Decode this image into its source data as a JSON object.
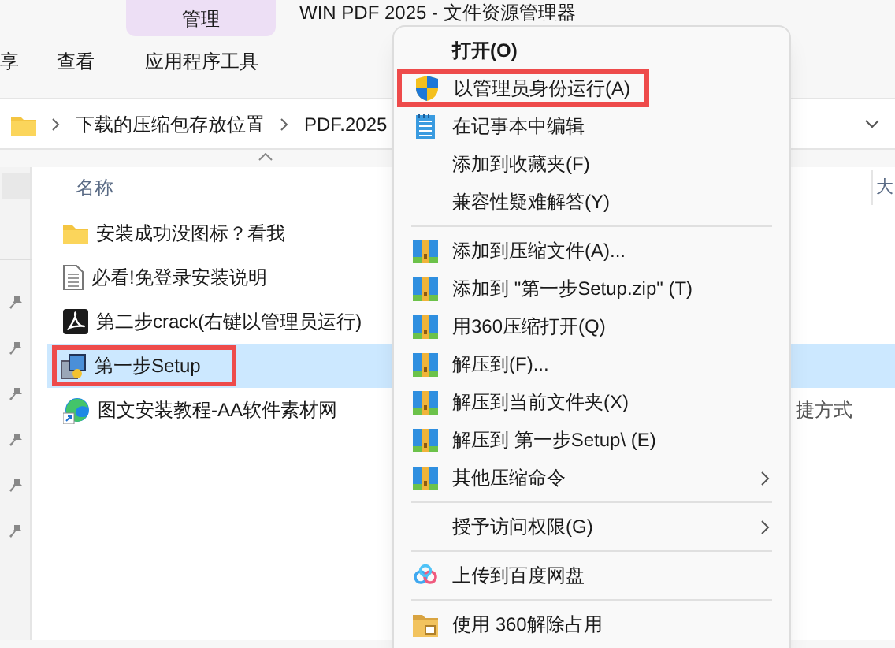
{
  "window": {
    "title": "WIN PDF 2025 - 文件资源管理器",
    "context_tab": "管理"
  },
  "ribbon": {
    "tabs": [
      {
        "label": "享"
      },
      {
        "label": "查看"
      },
      {
        "label": "应用程序工具"
      }
    ]
  },
  "address_bar": {
    "crumbs": [
      "下载的压缩包存放位置",
      "PDF.2025"
    ]
  },
  "columns": [
    {
      "label": "名称"
    },
    {
      "label": "大"
    }
  ],
  "files": [
    {
      "name": "安装成功没图标？看我",
      "kind": "folder",
      "selected": false,
      "highlighted": false
    },
    {
      "name": "必看!免登录安装说明",
      "kind": "document",
      "selected": false,
      "highlighted": false
    },
    {
      "name": "第二步crack(右键以管理员运行)",
      "kind": "pdf",
      "selected": false,
      "highlighted": false
    },
    {
      "name": "第一步Setup",
      "kind": "installer",
      "selected": true,
      "highlighted": true
    },
    {
      "name": "图文安装教程-AA软件素材网",
      "kind": "shortcut",
      "selected": false,
      "highlighted": false,
      "type": "捷方式"
    }
  ],
  "context_menu": [
    {
      "kind": "plain",
      "label": "打开(O)",
      "bold": true,
      "highlighted": false,
      "submenu": false
    },
    {
      "kind": "shield",
      "label": "以管理员身份运行(A)",
      "bold": false,
      "highlighted": true,
      "submenu": false
    },
    {
      "kind": "notepad",
      "label": "在记事本中编辑",
      "bold": false,
      "highlighted": false,
      "submenu": false
    },
    {
      "kind": "plain",
      "label": "添加到收藏夹(F)",
      "bold": false,
      "highlighted": false,
      "submenu": false
    },
    {
      "kind": "plain",
      "label": "兼容性疑难解答(Y)",
      "bold": false,
      "highlighted": false,
      "submenu": false
    },
    {
      "kind": "separator"
    },
    {
      "kind": "archive",
      "label": "添加到压缩文件(A)...",
      "bold": false,
      "highlighted": false,
      "submenu": false
    },
    {
      "kind": "archive",
      "label": "添加到 \"第一步Setup.zip\" (T)",
      "bold": false,
      "highlighted": false,
      "submenu": false
    },
    {
      "kind": "archive",
      "label": "用360压缩打开(Q)",
      "bold": false,
      "highlighted": false,
      "submenu": false
    },
    {
      "kind": "archive",
      "label": "解压到(F)...",
      "bold": false,
      "highlighted": false,
      "submenu": false
    },
    {
      "kind": "archive",
      "label": "解压到当前文件夹(X)",
      "bold": false,
      "highlighted": false,
      "submenu": false
    },
    {
      "kind": "archive",
      "label": "解压到 第一步Setup\\ (E)",
      "bold": false,
      "highlighted": false,
      "submenu": false
    },
    {
      "kind": "archive",
      "label": "其他压缩命令",
      "bold": false,
      "highlighted": false,
      "submenu": true
    },
    {
      "kind": "separator"
    },
    {
      "kind": "plain",
      "label": "授予访问权限(G)",
      "bold": false,
      "highlighted": false,
      "submenu": true
    },
    {
      "kind": "separator"
    },
    {
      "kind": "cloud",
      "label": "上传到百度网盘",
      "bold": false,
      "highlighted": false,
      "submenu": false
    },
    {
      "kind": "separator"
    },
    {
      "kind": "lock",
      "label": "使用 360解除占用",
      "bold": false,
      "highlighted": false,
      "submenu": false
    }
  ]
}
